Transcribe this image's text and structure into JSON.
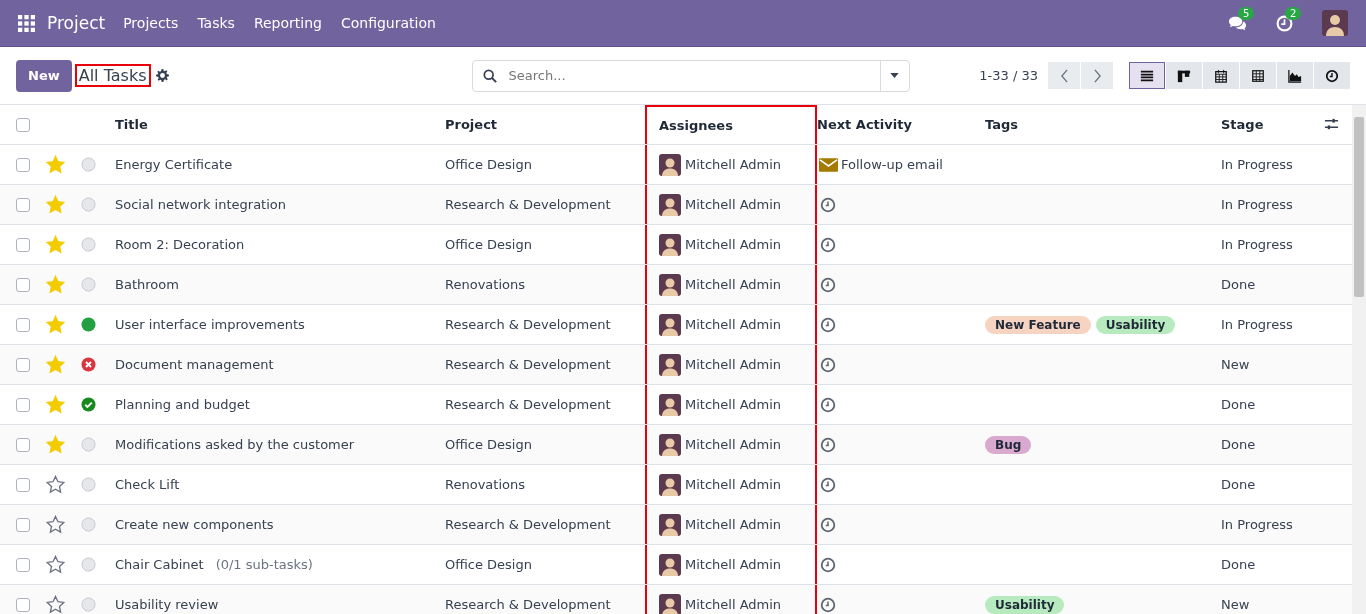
{
  "navbar": {
    "app": "Project",
    "menu": [
      "Projects",
      "Tasks",
      "Reporting",
      "Configuration"
    ],
    "messages_count": "5",
    "activities_count": "2"
  },
  "control_panel": {
    "new_button": "New",
    "title": "All Tasks",
    "title_highlighted": true,
    "search": {
      "placeholder": "Search..."
    },
    "pager": "1-33 / 33",
    "views": [
      {
        "kind": "list",
        "selected": true
      },
      {
        "kind": "kanban",
        "selected": false
      },
      {
        "kind": "calendar",
        "selected": false
      },
      {
        "kind": "pivot",
        "selected": false
      },
      {
        "kind": "graph",
        "selected": false
      },
      {
        "kind": "activity",
        "selected": false
      }
    ]
  },
  "table": {
    "all_checked": false,
    "columns": [
      {
        "label": "Title",
        "highlighted": false
      },
      {
        "label": "Project",
        "highlighted": false
      },
      {
        "label": "Assignees",
        "highlighted": true
      },
      {
        "label": "Next Activity",
        "highlighted": false
      },
      {
        "label": "Tags",
        "highlighted": false
      },
      {
        "label": "Stage",
        "highlighted": false
      }
    ],
    "rows": [
      {
        "checked": false,
        "starred": true,
        "status": {
          "kind": "normal"
        },
        "title": "Energy Certificate",
        "project": "Office Design",
        "assignee": "Mitchell Admin",
        "activity": {
          "kind": "email",
          "label": "Follow-up email"
        },
        "tags": [],
        "stage": "In Progress"
      },
      {
        "checked": false,
        "starred": true,
        "status": {
          "kind": "normal"
        },
        "title": "Social network integration",
        "project": "Research & Development",
        "assignee": "Mitchell Admin",
        "activity": {
          "kind": "none"
        },
        "tags": [],
        "stage": "In Progress"
      },
      {
        "checked": false,
        "starred": true,
        "status": {
          "kind": "normal"
        },
        "title": "Room 2: Decoration",
        "project": "Office Design",
        "assignee": "Mitchell Admin",
        "activity": {
          "kind": "none"
        },
        "tags": [],
        "stage": "In Progress"
      },
      {
        "checked": false,
        "starred": true,
        "status": {
          "kind": "normal"
        },
        "title": "Bathroom",
        "project": "Renovations",
        "assignee": "Mitchell Admin",
        "activity": {
          "kind": "none"
        },
        "tags": [],
        "stage": "Done"
      },
      {
        "checked": false,
        "starred": true,
        "status": {
          "kind": "done"
        },
        "title": "User interface improvements",
        "project": "Research & Development",
        "assignee": "Mitchell Admin",
        "activity": {
          "kind": "none"
        },
        "tags": [
          {
            "label": "New Feature",
            "color": "#f7d3c2"
          },
          {
            "label": "Usability",
            "color": "#b7ebbf"
          }
        ],
        "stage": "In Progress"
      },
      {
        "checked": false,
        "starred": true,
        "status": {
          "kind": "blocked"
        },
        "title": "Document management",
        "project": "Research & Development",
        "assignee": "Mitchell Admin",
        "activity": {
          "kind": "none"
        },
        "tags": [],
        "stage": "New"
      },
      {
        "checked": false,
        "starred": true,
        "status": {
          "kind": "approved"
        },
        "title": "Planning and budget",
        "project": "Research & Development",
        "assignee": "Mitchell Admin",
        "activity": {
          "kind": "none"
        },
        "tags": [],
        "stage": "Done"
      },
      {
        "checked": false,
        "starred": true,
        "status": {
          "kind": "normal"
        },
        "title": "Modifications asked by the customer",
        "project": "Office Design",
        "assignee": "Mitchell Admin",
        "activity": {
          "kind": "none"
        },
        "tags": [
          {
            "label": "Bug",
            "color": "#d9a9cf"
          }
        ],
        "stage": "Done"
      },
      {
        "checked": false,
        "starred": false,
        "status": {
          "kind": "normal"
        },
        "title": "Check Lift",
        "project": "Renovations",
        "assignee": "Mitchell Admin",
        "activity": {
          "kind": "none"
        },
        "tags": [],
        "stage": "Done"
      },
      {
        "checked": false,
        "starred": false,
        "status": {
          "kind": "normal"
        },
        "title": "Create new components",
        "project": "Research & Development",
        "assignee": "Mitchell Admin",
        "activity": {
          "kind": "none"
        },
        "tags": [],
        "stage": "In Progress"
      },
      {
        "checked": false,
        "starred": false,
        "status": {
          "kind": "normal"
        },
        "title": "Chair Cabinet",
        "subtasks": "(0/1 sub-tasks)",
        "project": "Office Design",
        "assignee": "Mitchell Admin",
        "activity": {
          "kind": "none"
        },
        "tags": [],
        "stage": "Done"
      },
      {
        "checked": false,
        "starred": false,
        "status": {
          "kind": "normal"
        },
        "title": "Usability review",
        "project": "Research & Development",
        "assignee": "Mitchell Admin",
        "activity": {
          "kind": "none"
        },
        "tags": [
          {
            "label": "Usability",
            "color": "#b7ebbf"
          }
        ],
        "stage": "New"
      }
    ]
  }
}
